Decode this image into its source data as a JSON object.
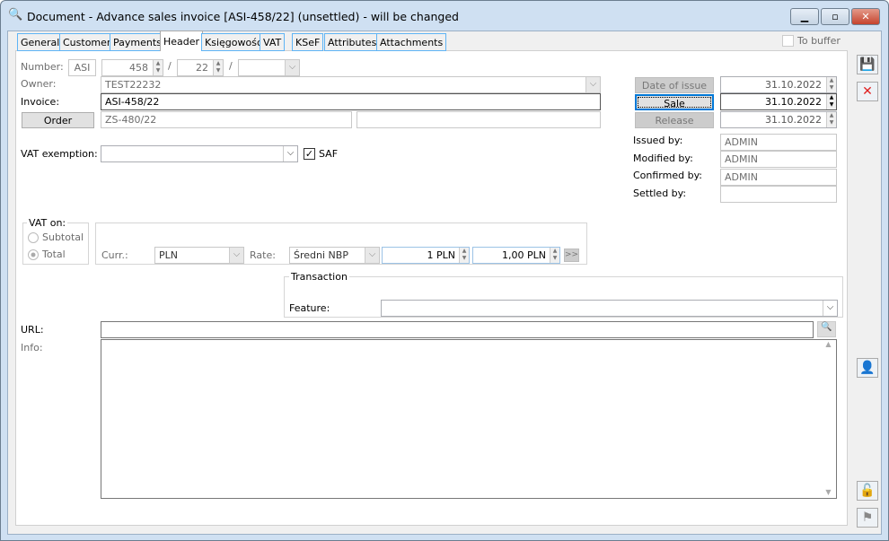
{
  "window": {
    "title": "Document - Advance sales invoice [ASI-458/22] (unsettled) - will be changed"
  },
  "tabs": [
    {
      "label": "General"
    },
    {
      "label": "Customer"
    },
    {
      "label": "Payments"
    },
    {
      "label": "Header",
      "active": true
    },
    {
      "label": "Księgowość"
    },
    {
      "label": "VAT"
    },
    {
      "label": "KSeF"
    },
    {
      "label": "Attributes"
    },
    {
      "label": "Attachments"
    }
  ],
  "to_buffer": {
    "label": "To buffer",
    "checked": false
  },
  "form": {
    "number_label": "Number:",
    "number_prefix": "ASI",
    "number_value": "458",
    "number_year": "22",
    "number_series": "",
    "owner_label": "Owner:",
    "owner_value": "TEST22232",
    "invoice_label": "Invoice:",
    "invoice_value": "ASI-458/22",
    "order_button": "Order",
    "order_value": "ZS-480/22",
    "order_extra": "",
    "vat_exemption_label": "VAT exemption:",
    "vat_exemption_value": "",
    "saf_label": "SAF",
    "saf_checked": true,
    "vat_on_label": "VAT on:",
    "vat_on_options": [
      "Subtotal",
      "Total"
    ],
    "vat_on_selected": "Total",
    "curr_label": "Curr.:",
    "curr_value": "PLN",
    "rate_label": "Rate:",
    "rate_value": "Średni NBP",
    "rate_amount1": "1 PLN",
    "rate_amount2": "1,00 PLN",
    "rate_more": ">>",
    "transaction_label": "Transaction",
    "feature_label": "Feature:",
    "feature_value": "",
    "url_label": "URL:",
    "url_value": "",
    "info_label": "Info:",
    "info_value": ""
  },
  "dates": {
    "issue_button": "Date of issue",
    "issue_value": "31.10.2022",
    "sale_button": "Sale",
    "sale_value": "31.10.2022",
    "release_button": "Release",
    "release_value": "31.10.2022"
  },
  "people": {
    "issued_label": "Issued by:",
    "issued_value": "ADMIN",
    "modified_label": "Modified by:",
    "modified_value": "ADMIN",
    "confirmed_label": "Confirmed by:",
    "confirmed_value": "ADMIN",
    "settled_label": "Settled by:",
    "settled_value": ""
  }
}
